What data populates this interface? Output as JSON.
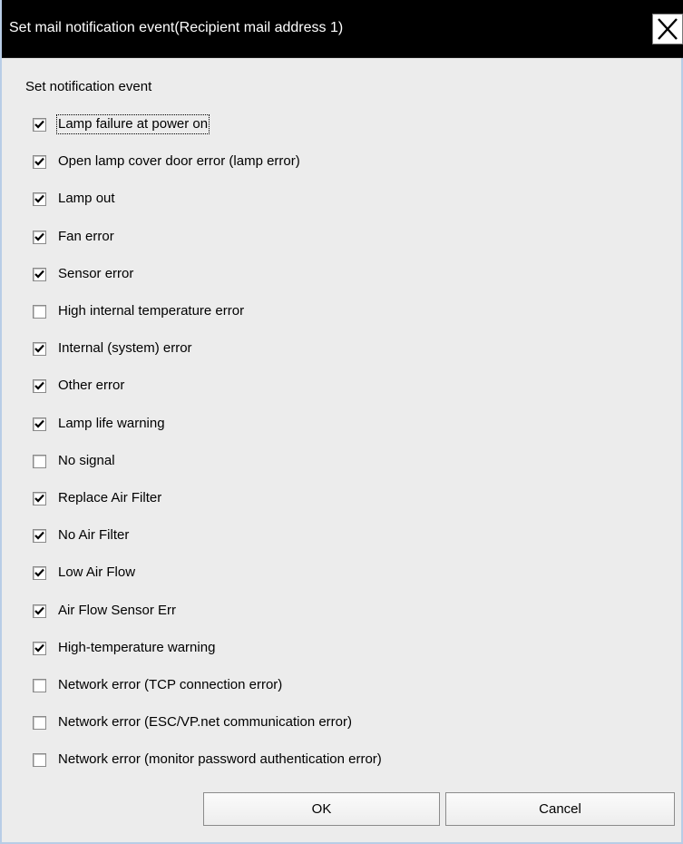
{
  "window": {
    "title": "Set mail notification event(Recipient mail address 1)",
    "close_icon": "close-icon"
  },
  "section": {
    "label": "Set notification event"
  },
  "events": [
    {
      "label": "Lamp failure at power on",
      "checked": true,
      "focused": true
    },
    {
      "label": "Open lamp cover door error (lamp error)",
      "checked": true
    },
    {
      "label": "Lamp out",
      "checked": true
    },
    {
      "label": "Fan error",
      "checked": true
    },
    {
      "label": "Sensor error",
      "checked": true
    },
    {
      "label": "High internal temperature error",
      "checked": false
    },
    {
      "label": "Internal (system) error",
      "checked": true
    },
    {
      "label": "Other error",
      "checked": true
    },
    {
      "label": "Lamp life warning",
      "checked": true
    },
    {
      "label": "No signal",
      "checked": false
    },
    {
      "label": "Replace Air Filter",
      "checked": true
    },
    {
      "label": "No Air Filter",
      "checked": true
    },
    {
      "label": "Low Air Flow",
      "checked": true
    },
    {
      "label": "Air Flow Sensor Err",
      "checked": true
    },
    {
      "label": "High-temperature warning",
      "checked": true
    },
    {
      "label": "Network error (TCP connection error)",
      "checked": false
    },
    {
      "label": "Network error (ESC/VP.net communication error)",
      "checked": false
    },
    {
      "label": "Network error (monitor password authentication error)",
      "checked": false
    }
  ],
  "buttons": {
    "ok": "OK",
    "cancel": "Cancel"
  }
}
